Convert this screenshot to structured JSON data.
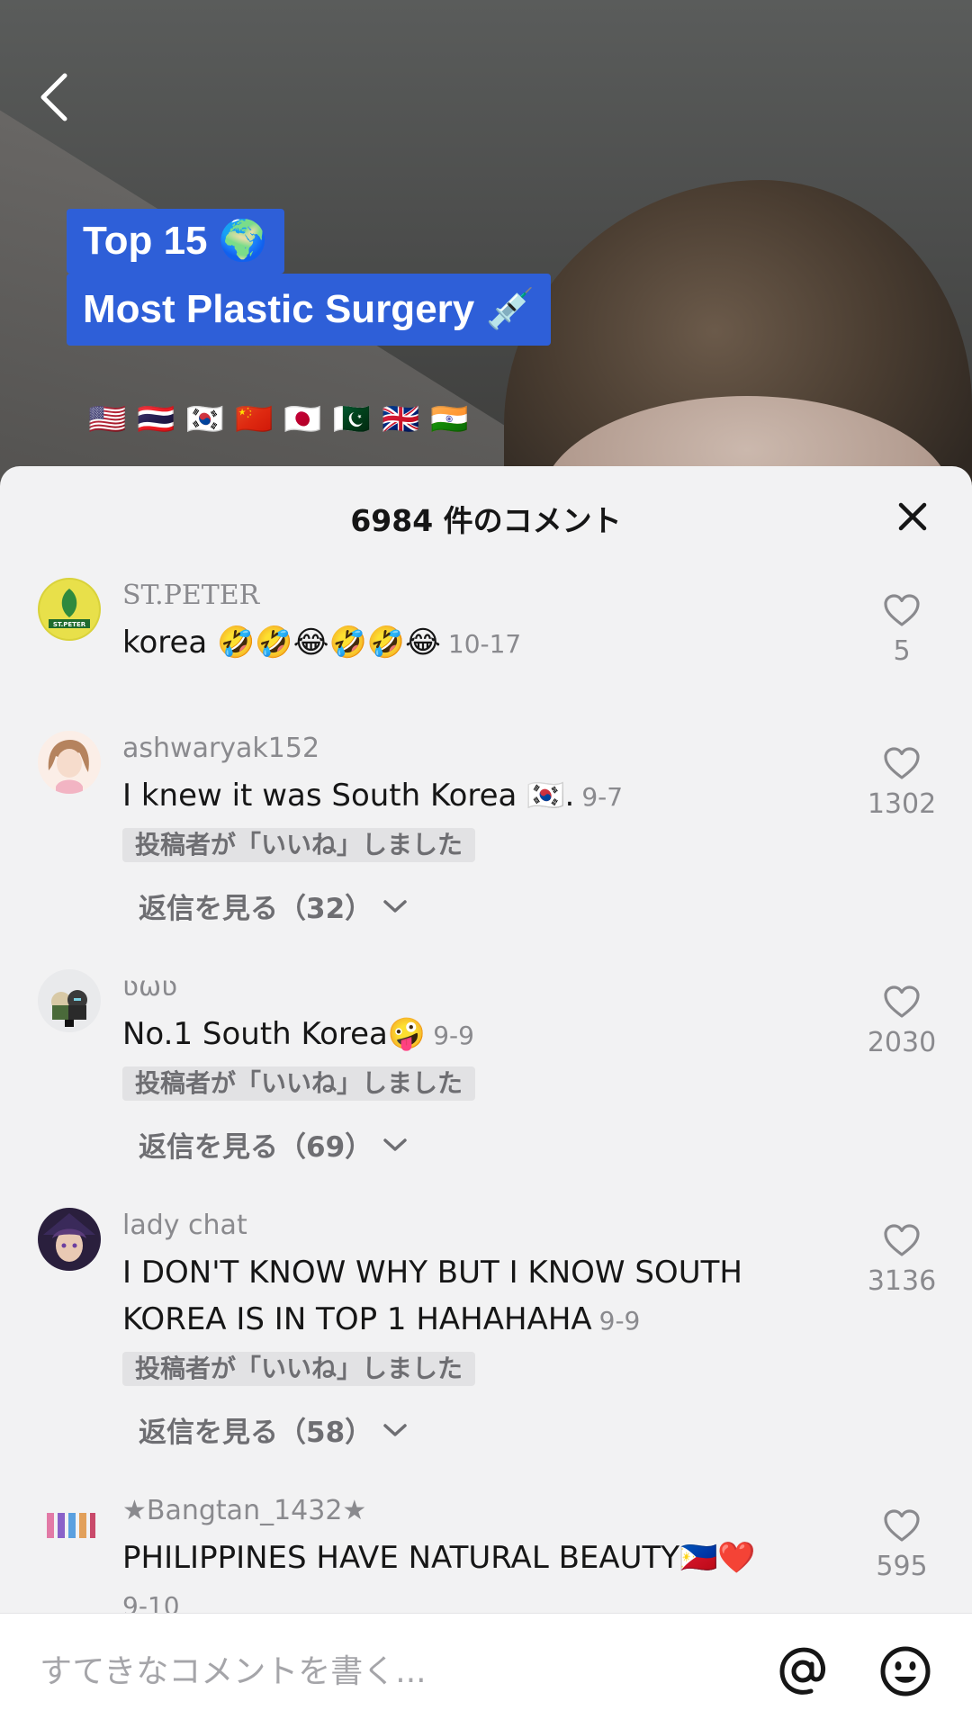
{
  "video": {
    "caption_line1": "Top 15 🌍",
    "caption_line2": "Most Plastic Surgery 💉",
    "flags": [
      "🇺🇸",
      "🇹🇭",
      "🇰🇷",
      "🇨🇳",
      "🇯🇵",
      "🇵🇰",
      "🇬🇧",
      "🇮🇳"
    ]
  },
  "sheet": {
    "title": "6984 件のコメント"
  },
  "comments": [
    {
      "username": "ST.PETER",
      "text": "korea 🤣🤣😂🤣🤣😂",
      "date": "10-17",
      "likes": "5",
      "liked_by_creator": "",
      "replies": "",
      "avatar": "green-logo"
    },
    {
      "username": "ashwaryak152",
      "text": "I knew it was South Korea 🇰🇷.",
      "date": "9-7",
      "likes": "1302",
      "liked_by_creator": "投稿者が「いいね」しました",
      "replies": "返信を見る（32）",
      "avatar": "girl-illustration"
    },
    {
      "username": "ʋωʋ",
      "text": "No.1 South Korea🤪",
      "date": "9-9",
      "likes": "2030",
      "liked_by_creator": "投稿者が「いいね」しました",
      "replies": "返信を見る（69）",
      "avatar": "cartoon-sticker"
    },
    {
      "username": "lady chat",
      "text": "I DON'T KNOW WHY BUT I KNOW SOUTH KOREA IS IN TOP 1 HAHAHAHA",
      "date": "9-9",
      "likes": "3136",
      "liked_by_creator": "投稿者が「いいね」しました",
      "replies": "返信を見る（58）",
      "avatar": "anime-portrait"
    },
    {
      "username": "★Bangtan_1432★",
      "text": "PHILIPPINES HAVE NATURAL BEAUTY🇵🇭❤️",
      "date": "9-10",
      "likes": "595",
      "liked_by_creator": "",
      "replies": "",
      "avatar": "bts-logo"
    }
  ],
  "input": {
    "placeholder": "すてきなコメントを書く..."
  },
  "icons": {
    "back": "chevron-left-icon",
    "close": "close-icon",
    "like": "heart-outline-icon",
    "expand": "chevron-down-icon",
    "mention": "at-sign-icon",
    "emoji": "smiley-icon"
  },
  "colors": {
    "sheet_bg": "#f2f2f3",
    "caption_bg": "#2e5fd8",
    "muted_text": "#8a8a8e",
    "primary_text": "#161616"
  }
}
